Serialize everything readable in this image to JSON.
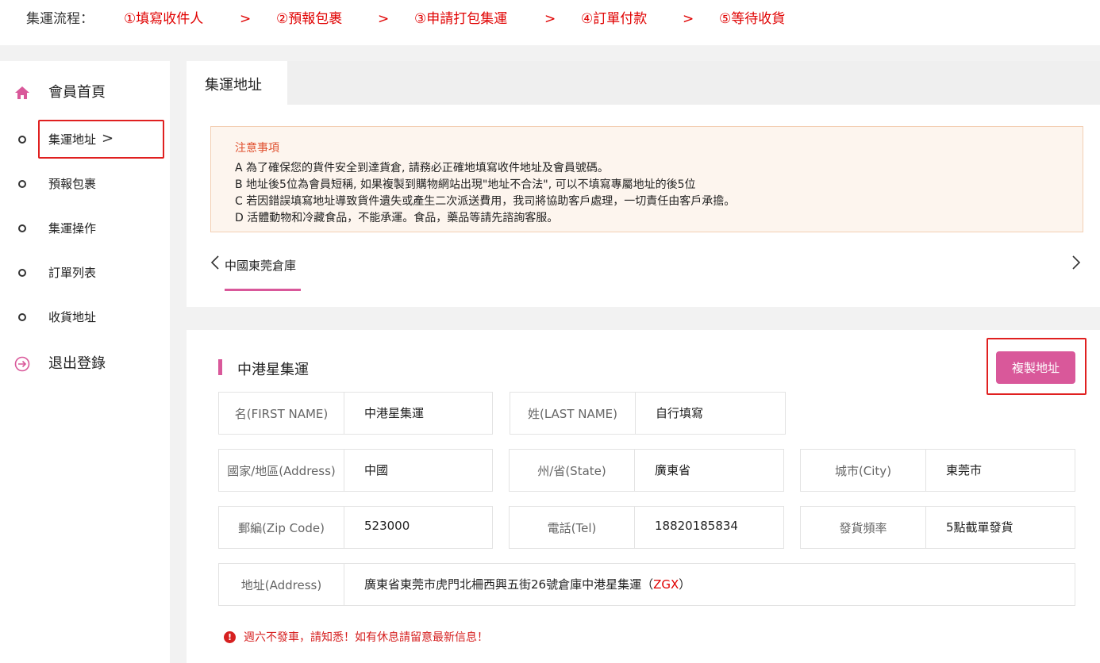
{
  "flow": {
    "label": "集運流程：",
    "steps": [
      "①填寫收件人",
      "②預報包裹",
      "③申請打包集運",
      "④訂單付款",
      "⑤等待收貨"
    ],
    "separator": ">"
  },
  "sidebar": {
    "items": [
      {
        "label": "會員首頁",
        "icon": "home-icon"
      },
      {
        "label": "集運地址",
        "icon": "circle-icon"
      },
      {
        "label": "預報包裹",
        "icon": "circle-icon"
      },
      {
        "label": "集運操作",
        "icon": "circle-icon"
      },
      {
        "label": "訂單列表",
        "icon": "circle-icon"
      },
      {
        "label": "收貨地址",
        "icon": "circle-icon"
      },
      {
        "label": "退出登錄",
        "icon": "logout-icon"
      }
    ],
    "active_chevron": ">"
  },
  "tab": {
    "title": "集運地址"
  },
  "notice": {
    "title": "注意事項",
    "lines": [
      "A 為了確保您的貨件安全到達貨倉, 請務必正確地填寫收件地址及會員號碼。",
      "B 地址後5位為會員短稱, 如果複製到購物網站出現\"地址不合法\", 可以不填寫專屬地址的後5位",
      "C 若因錯誤填寫地址導致貨件遺失或產生二次派送費用，我司將協助客戶處理，一切責任由客戶承擔。",
      "D 活體動物和冷藏食品，不能承運。食品，藥品等請先諮詢客服。"
    ]
  },
  "warehouse": {
    "name": "中國東莞倉庫",
    "prev": "〈",
    "next": "〉"
  },
  "section": {
    "title": "中港星集運",
    "copy_button": "複製地址"
  },
  "fields": {
    "first_name": {
      "label": "名(FIRST NAME)",
      "value": "中港星集運"
    },
    "last_name": {
      "label": "姓(LAST NAME)",
      "value": "自行填寫"
    },
    "country": {
      "label": "國家/地區(Address)",
      "value": "中國"
    },
    "state": {
      "label": "州/省(State)",
      "value": "廣東省"
    },
    "city": {
      "label": "城市(City)",
      "value": "東莞市"
    },
    "zip": {
      "label": "郵編(Zip Code)",
      "value": "523000"
    },
    "tel": {
      "label": "電話(Tel)",
      "value": "18820185834"
    },
    "ship_freq": {
      "label": "發貨頻率",
      "value": "5點截單發貨"
    },
    "address": {
      "label": "地址(Address)",
      "value": "廣東省東莞市虎門北柵西興五街26號倉庫中港星集運（",
      "code": "ZGX",
      "code_tail": "）"
    }
  },
  "warning": {
    "icon": "!",
    "text": "週六不發車，請知悉！如有休息請留意最新信息！"
  },
  "colors": {
    "accent": "#d9589a",
    "alert_red": "#e00000",
    "notice_bg": "#fdf5ee"
  }
}
